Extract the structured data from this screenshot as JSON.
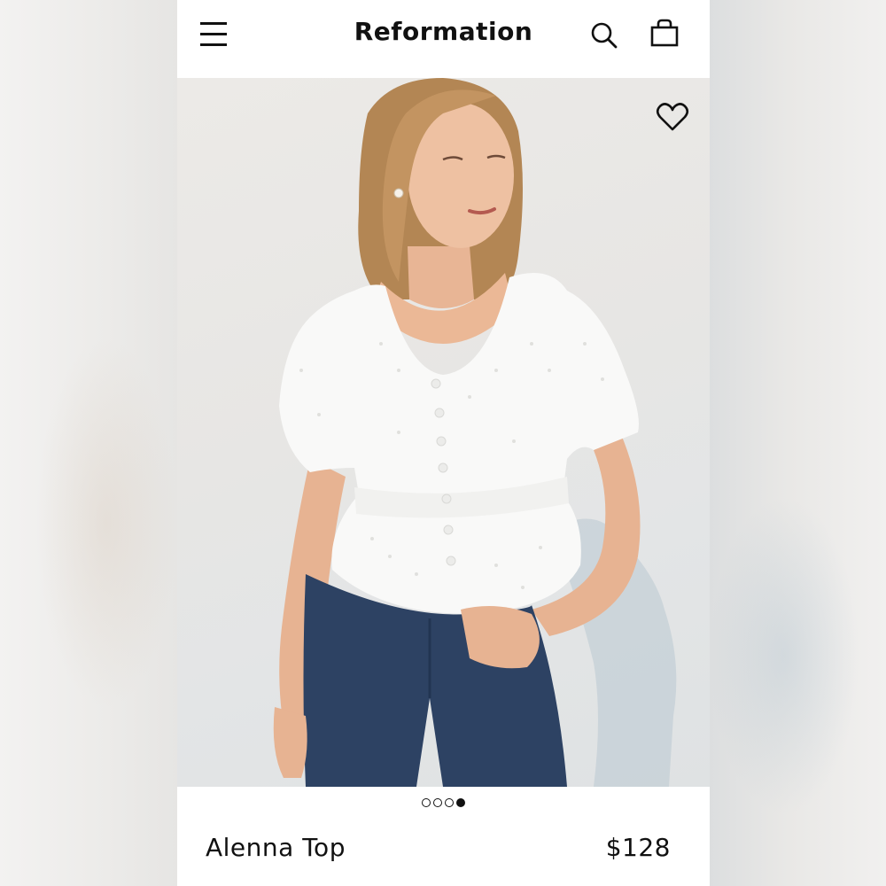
{
  "header": {
    "brand": "Reformation",
    "menu_icon": "hamburger-menu-icon",
    "search_icon": "search-icon",
    "bag_icon": "shopping-bag-icon"
  },
  "product": {
    "image_subject": "product-photo",
    "favorite_icon": "heart-outline-icon",
    "carousel": {
      "total": 4,
      "active_index": 4
    },
    "name": "Alenna Top",
    "price": "$128"
  },
  "colors": {
    "text": "#111111",
    "background": "#ffffff",
    "top_white": "#fafafa",
    "jeans_blue": "#2d4263"
  }
}
